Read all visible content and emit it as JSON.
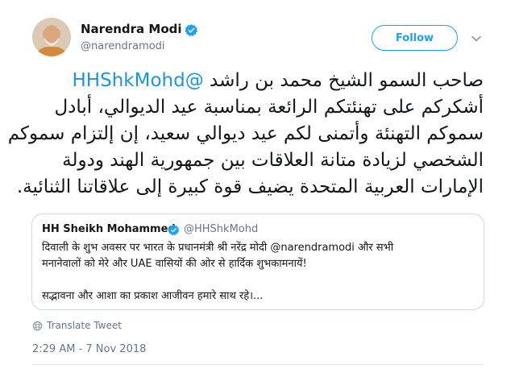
{
  "author": {
    "name": "Narendra Modi",
    "handle": "@narendramodi",
    "verified": true,
    "avatar_icon": "profile-photo"
  },
  "actions": {
    "follow_label": "Follow",
    "more_icon": "chevron-down-icon"
  },
  "tweet": {
    "mention": "@HHShkMohd",
    "lines": [
      "صاحب السمو الشيخ محمد بن راشد",
      "أشكركم على تهنئتكم الرائعة بمناسبة عيد الديوالي، أبادل",
      "سموكم التهنئة وأتمنى لكم عيد ديوالي سعيد، إن إلتزام سموكم",
      "الشخصي لزيادة متانة العلاقات بين جمهورية الهند ودولة",
      "الإمارات العربية المتحدة يضيف قوة كبيرة إلى علاقاتنا الثنائية."
    ]
  },
  "quoted_tweet": {
    "name": "HH Sheikh Mohammed",
    "handle": "@HHShkMohd",
    "verified": true,
    "lines": [
      "दिवाली के शुभ अवसर पर भारत के प्रधानमंत्री श्री नरेंद्र मोदी @narendramodi और सभी",
      "मनानेवालों को मेरे और UAE वासियों की ओर से हार्दिक शुभकामनायें!",
      "सद्भावना और आशा का प्रकाश आजीवन हमारे साथ रहे।..."
    ]
  },
  "translate_label": "Translate Tweet",
  "timestamp": "2:29 AM - 7 Nov 2018",
  "colors": {
    "accent": "#1da1f2",
    "link": "#1b95e0",
    "secondary_text": "#657786",
    "border": "#ccd6dd"
  }
}
